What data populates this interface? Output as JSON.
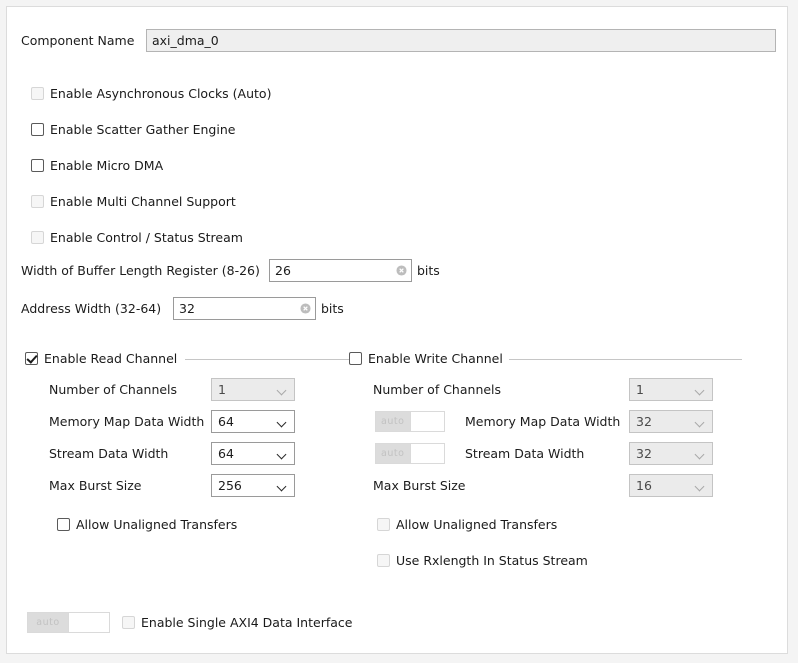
{
  "component": {
    "label": "Component Name",
    "value": "axi_dma_0",
    "placeholder": "axi_dma_0"
  },
  "options": [
    {
      "id": "async-clocks",
      "label": "Enable Asynchronous Clocks (Auto)",
      "checked": false,
      "enabled": false
    },
    {
      "id": "scatter-gather",
      "label": "Enable Scatter Gather Engine",
      "checked": false,
      "enabled": true
    },
    {
      "id": "micro-dma",
      "label": "Enable Micro DMA",
      "checked": false,
      "enabled": true
    },
    {
      "id": "multi-channel",
      "label": "Enable Multi Channel Support",
      "checked": false,
      "enabled": false
    },
    {
      "id": "control-status-stream",
      "label": "Enable Control / Status Stream",
      "checked": false,
      "enabled": false
    }
  ],
  "fields": [
    {
      "id": "buffer-length-register",
      "label": "Width of Buffer Length Register (8-26)",
      "value": "26",
      "placeholder": "26",
      "unit": "bits",
      "clear_icon": "clear-circle-icon"
    },
    {
      "id": "address-width",
      "label": "Address Width (32-64)",
      "value": "32",
      "placeholder": "32",
      "unit": "bits",
      "clear_icon": "clear-circle-icon"
    }
  ],
  "read_channel": {
    "title": "Enable Read Channel",
    "checked": true,
    "enabled": true,
    "rows": [
      {
        "id": "number-of-channels",
        "label": "Number of Channels",
        "value": "1",
        "enabled": false,
        "auto_toggle": false
      },
      {
        "id": "memory-map-data-width",
        "label": "Memory Map Data Width",
        "value": "64",
        "enabled": true,
        "auto_toggle": false
      },
      {
        "id": "stream-data-width",
        "label": "Stream Data Width",
        "value": "64",
        "enabled": true,
        "auto_toggle": false
      },
      {
        "id": "max-burst-size",
        "label": "Max Burst Size",
        "value": "256",
        "enabled": true,
        "auto_toggle": false
      }
    ],
    "checkboxes": [
      {
        "id": "allow-unaligned-transfers",
        "label": "Allow Unaligned Transfers",
        "checked": false,
        "enabled": true
      }
    ]
  },
  "write_channel": {
    "title": "Enable Write Channel",
    "checked": false,
    "enabled": true,
    "rows": [
      {
        "id": "number-of-channels",
        "label": "Number of Channels",
        "value": "1",
        "enabled": false,
        "auto_toggle": false
      },
      {
        "id": "memory-map-data-width",
        "label": "Memory Map Data Width",
        "value": "32",
        "enabled": false,
        "auto_toggle": true,
        "auto_label": "auto"
      },
      {
        "id": "stream-data-width",
        "label": "Stream Data Width",
        "value": "32",
        "enabled": false,
        "auto_toggle": true,
        "auto_label": "auto"
      },
      {
        "id": "max-burst-size",
        "label": "Max Burst Size",
        "value": "16",
        "enabled": false,
        "auto_toggle": false
      }
    ],
    "checkboxes": [
      {
        "id": "allow-unaligned-transfers",
        "label": "Allow Unaligned Transfers",
        "checked": false,
        "enabled": false
      },
      {
        "id": "use-rxlength-in-status-stream",
        "label": "Use Rxlength In Status Stream",
        "checked": false,
        "enabled": false
      }
    ]
  },
  "footer": {
    "auto_label": "auto",
    "checkbox": {
      "id": "single-axi4-data-interface",
      "label": "Enable Single AXI4 Data Interface",
      "checked": false,
      "enabled": false
    }
  },
  "colors": {
    "background": "#ffffff",
    "frame": "#f4f4f4",
    "border": "#dcdcdc",
    "disabled_text": "#b8b8b8",
    "rule": "#c6c6c6",
    "readonly_field": "#efefef"
  }
}
